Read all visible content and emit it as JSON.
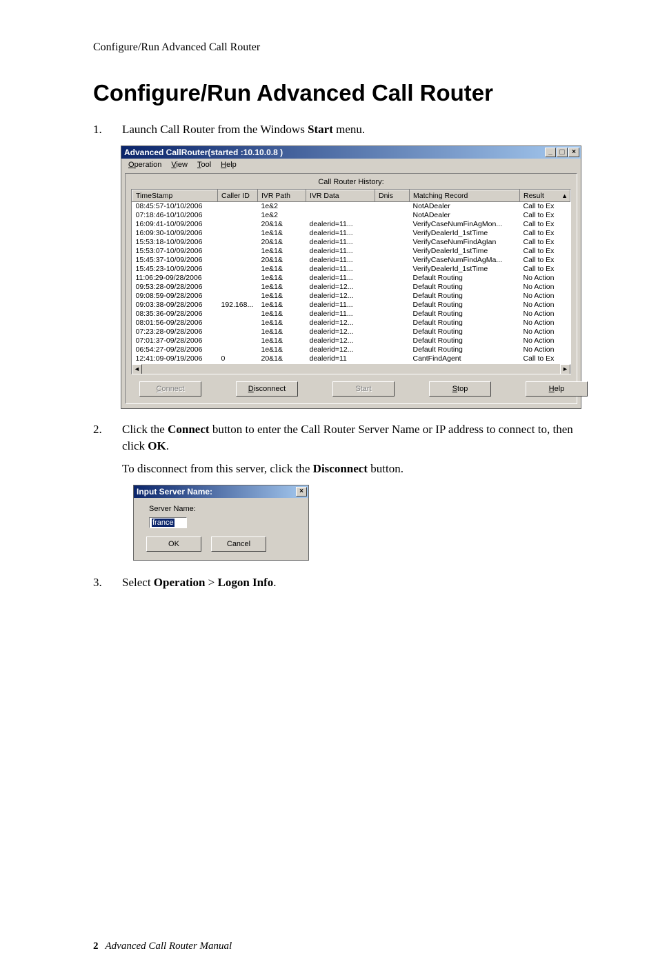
{
  "header": "Configure/Run Advanced Call Router",
  "title": "Configure/Run Advanced Call Router",
  "steps": {
    "s1_num": "1.",
    "s1_a": "Launch Call Router from the Windows ",
    "s1_b": "Start",
    "s1_c": " menu.",
    "s2_num": "2.",
    "s2_a": "Click the ",
    "s2_b": "Connect",
    "s2_c": " button to enter the Call Router Server Name or IP address to connect to, then click ",
    "s2_d": "OK",
    "s2_e": ".",
    "s2_f": "To disconnect from this server, click the ",
    "s2_g": "Disconnect",
    "s2_h": " button.",
    "s3_num": "3.",
    "s3_a": "Select ",
    "s3_b": "Operation",
    "s3_c": " > ",
    "s3_d": "Logon Info",
    "s3_e": "."
  },
  "win": {
    "title": "Advanced CallRouter(started :10.10.0.8 )",
    "menu": {
      "operation": "Operation",
      "view": "View",
      "tool": "Tool",
      "help": "Help"
    },
    "subtitle": "Call Router History:",
    "cols": {
      "ts": "TimeStamp",
      "cid": "Caller ID",
      "path": "IVR Path",
      "data": "IVR Data",
      "dnis": "Dnis",
      "match": "Matching Record",
      "result": "Result"
    },
    "rows": [
      {
        "ts": "08:45:57-10/10/2006",
        "cid": "",
        "path": "1e&2",
        "data": "",
        "match": "NotADealer",
        "result": "Call to Ex"
      },
      {
        "ts": "07:18:46-10/10/2006",
        "cid": "",
        "path": "1e&2",
        "data": "",
        "match": "NotADealer",
        "result": "Call to Ex"
      },
      {
        "ts": "16:09:41-10/09/2006",
        "cid": "",
        "path": "20&1&",
        "data": "dealerid=11...",
        "match": "VerifyCaseNumFinAgMon...",
        "result": "Call to Ex"
      },
      {
        "ts": "16:09:30-10/09/2006",
        "cid": "",
        "path": "1e&1&",
        "data": "dealerid=11...",
        "match": "VerifyDealerId_1stTime",
        "result": "Call to Ex"
      },
      {
        "ts": "15:53:18-10/09/2006",
        "cid": "",
        "path": "20&1&",
        "data": "dealerid=11...",
        "match": "VerifyCaseNumFindAgIan",
        "result": "Call to Ex"
      },
      {
        "ts": "15:53:07-10/09/2006",
        "cid": "",
        "path": "1e&1&",
        "data": "dealerid=11...",
        "match": "VerifyDealerId_1stTime",
        "result": "Call to Ex"
      },
      {
        "ts": "15:45:37-10/09/2006",
        "cid": "",
        "path": "20&1&",
        "data": "dealerid=11...",
        "match": "VerifyCaseNumFindAgMa...",
        "result": "Call to Ex"
      },
      {
        "ts": "15:45:23-10/09/2006",
        "cid": "",
        "path": "1e&1&",
        "data": "dealerid=11...",
        "match": "VerifyDealerId_1stTime",
        "result": "Call to Ex"
      },
      {
        "ts": "11:06:29-09/28/2006",
        "cid": "",
        "path": "1e&1&",
        "data": "dealerid=11...",
        "match": "Default Routing",
        "result": "No Action"
      },
      {
        "ts": "09:53:28-09/28/2006",
        "cid": "",
        "path": "1e&1&",
        "data": "dealerid=12...",
        "match": "Default Routing",
        "result": "No Action"
      },
      {
        "ts": "09:08:59-09/28/2006",
        "cid": "",
        "path": "1e&1&",
        "data": "dealerid=12...",
        "match": "Default Routing",
        "result": "No Action"
      },
      {
        "ts": "09:03:38-09/28/2006",
        "cid": "192.168...",
        "path": "1e&1&",
        "data": "dealerid=11...",
        "match": "Default Routing",
        "result": "No Action"
      },
      {
        "ts": "08:35:36-09/28/2006",
        "cid": "",
        "path": "1e&1&",
        "data": "dealerid=11...",
        "match": "Default Routing",
        "result": "No Action"
      },
      {
        "ts": "08:01:56-09/28/2006",
        "cid": "",
        "path": "1e&1&",
        "data": "dealerid=12...",
        "match": "Default Routing",
        "result": "No Action"
      },
      {
        "ts": "07:23:28-09/28/2006",
        "cid": "",
        "path": "1e&1&",
        "data": "dealerid=12...",
        "match": "Default Routing",
        "result": "No Action"
      },
      {
        "ts": "07:01:37-09/28/2006",
        "cid": "",
        "path": "1e&1&",
        "data": "dealerid=12...",
        "match": "Default Routing",
        "result": "No Action"
      },
      {
        "ts": "06:54:27-09/28/2006",
        "cid": "",
        "path": "1e&1&",
        "data": "dealerid=12...",
        "match": "Default Routing",
        "result": "No Action"
      },
      {
        "ts": "12:41:09-09/19/2006",
        "cid": "0",
        "path": "20&1&",
        "data": "dealerid=11",
        "match": "CantFindAgent",
        "result": "Call to Ex"
      }
    ],
    "buttons": {
      "connect": "Connect",
      "disconnect": "Disconnect",
      "start": "Start",
      "stop": "Stop",
      "help": "Help"
    }
  },
  "dialog": {
    "title": "Input Server Name:",
    "label": "Server Name:",
    "value": "france",
    "ok": "OK",
    "cancel": "Cancel"
  },
  "footer": {
    "page": "2",
    "text": "Advanced Call Router Manual"
  }
}
